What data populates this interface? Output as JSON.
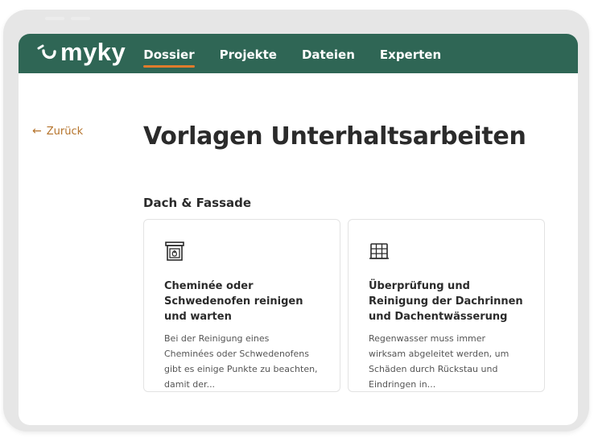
{
  "nav": {
    "logo": "myky",
    "items": [
      {
        "label": "Dossier",
        "active": true
      },
      {
        "label": "Projekte",
        "active": false
      },
      {
        "label": "Dateien",
        "active": false
      },
      {
        "label": "Experten",
        "active": false
      }
    ]
  },
  "back_label": "Zurück",
  "page_title": "Vorlagen Unterhaltsarbeiten",
  "section_title": "Dach & Fassade",
  "cards": [
    {
      "icon": "fireplace-icon",
      "title": "Cheminée oder Schwedenofen reinigen und warten",
      "description": "Bei der Reinigung eines Cheminées oder Schwedenofens gibt es einige Punkte zu beachten, damit der..."
    },
    {
      "icon": "roof-grid-icon",
      "title": "Überprüfung und Reinigung der Dachrinnen und Dachentwässerung",
      "description": "Regenwasser muss immer wirksam abgeleitet werden, um Schäden durch Rückstau und Eindringen in..."
    }
  ],
  "colors": {
    "nav_bg": "#2f6655",
    "accent": "#e07b2c",
    "link": "#b5732b"
  }
}
